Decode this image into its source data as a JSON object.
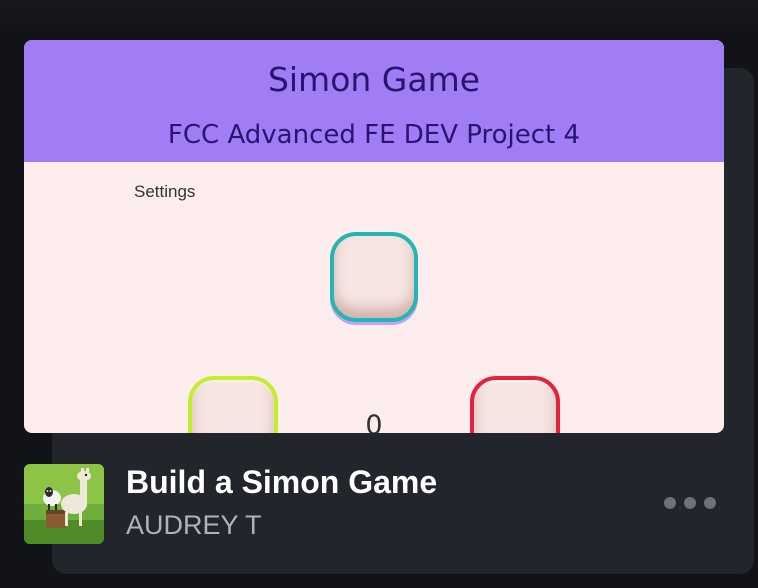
{
  "preview": {
    "title": "Simon Game",
    "subtitle": "FCC Advanced FE DEV Project 4",
    "settings_label": "Settings",
    "counter": "0",
    "pad_colors": {
      "top": "#25b5b5",
      "left": "#c2ee2c",
      "right": "#e8203f"
    },
    "header_color": "#a07cf5",
    "background_color": "#fdeeed"
  },
  "project": {
    "title": "Build a Simon Game",
    "author": "AUDREY T",
    "thumbnail_icon": "llama-and-sheep-icon"
  },
  "actions": {
    "more_icon": "more-options-icon"
  }
}
